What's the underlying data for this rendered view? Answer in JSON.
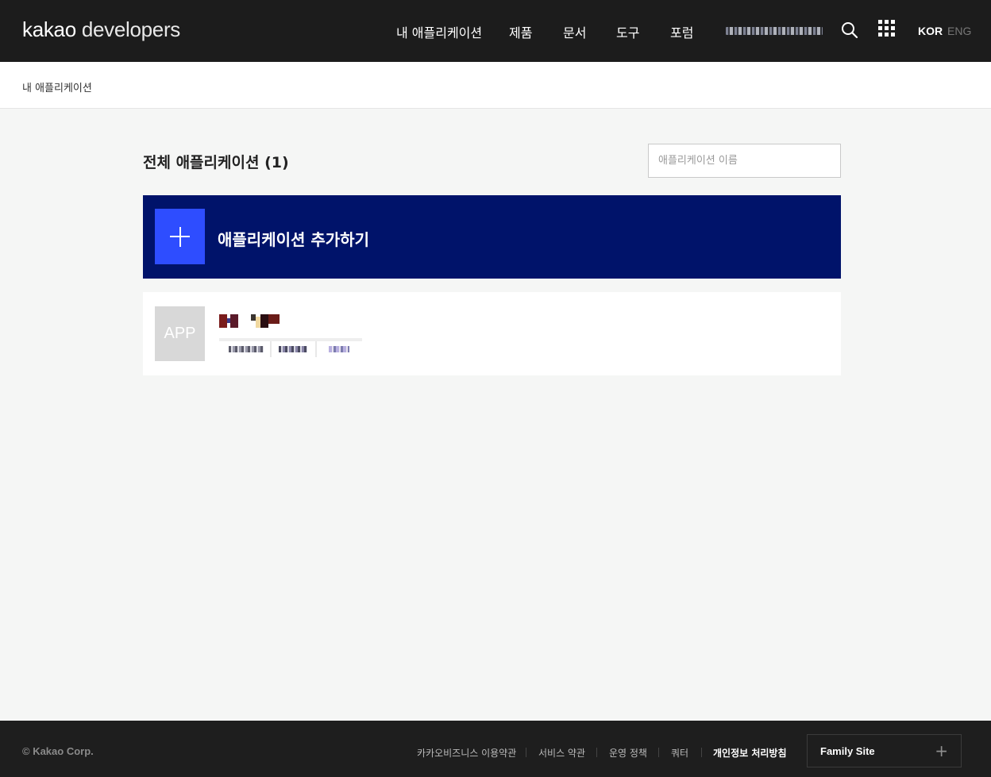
{
  "header": {
    "logo_bold": "kakao",
    "logo_rest": " developers",
    "nav": [
      {
        "label": "내 애플리케이션"
      },
      {
        "label": "제품"
      },
      {
        "label": "문서"
      },
      {
        "label": "도구"
      },
      {
        "label": "포럼"
      }
    ],
    "lang_kor": "KOR",
    "lang_eng": "ENG",
    "icons": {
      "search": "search-icon",
      "apps": "grid-menu-icon"
    }
  },
  "breadcrumb": "내 애플리케이션",
  "main": {
    "title": "전체 애플리케이션 (1)",
    "search_placeholder": "애플리케이션 이름",
    "add_label": "애플리케이션 추가하기",
    "apps": [
      {
        "thumb_label": "APP"
      }
    ]
  },
  "footer": {
    "copyright": "© Kakao Corp.",
    "links": [
      {
        "label": "카카오비즈니스 이용약관"
      },
      {
        "label": "서비스 약관"
      },
      {
        "label": "운영 정책"
      },
      {
        "label": "쿼터"
      },
      {
        "label": "개인정보 처리방침"
      }
    ],
    "family_site": "Family Site",
    "family_site_icon": "+"
  },
  "colors": {
    "header_bg": "#1c1c1c",
    "add_banner_bg": "#00136a",
    "add_icon_bg": "#2e4dff",
    "page_bg": "#f5f6f5",
    "footer_bg": "#1e1e1e"
  }
}
